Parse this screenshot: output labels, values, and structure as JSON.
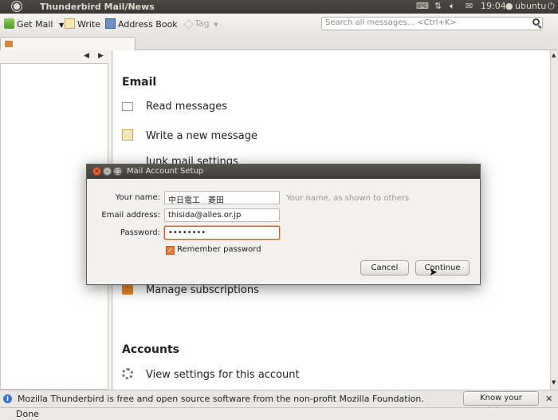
{
  "top_panel": {
    "title": "Thunderbird Mail/News",
    "time": "19:04",
    "user": "ubuntu"
  },
  "toolbar": {
    "get_mail": "Get Mail",
    "write": "Write",
    "address_book": "Address Book",
    "tag": "Tag",
    "search_placeholder": "Search all messages... <Ctrl+K>"
  },
  "content": {
    "email_heading": "Email",
    "read_messages": "Read messages",
    "write_message": "Write a new message",
    "junk_settings": "Junk mail settings",
    "manage_subscriptions": "Manage subscriptions",
    "accounts_heading": "Accounts",
    "view_settings": "View settings for this account"
  },
  "dialog": {
    "title": "Mail Account Setup",
    "name_label": "Your name:",
    "name_value": "中日電工　菱田",
    "name_hint": "Your name, as shown to others",
    "email_label": "Email address:",
    "email_value": "thisida@alles.or.jp",
    "password_label": "Password:",
    "password_value": "••••••••",
    "remember_label": "Remember password",
    "remember_checked": true,
    "cancel": "Cancel",
    "continue": "Continue"
  },
  "notification": {
    "message": "Mozilla Thunderbird is free and open source software from the non-profit Mozilla Foundation.",
    "rights_button": "Know your rights..."
  },
  "status": {
    "text": "Done"
  },
  "colors": {
    "panel": "#3c3b37",
    "accent": "#e0542e",
    "info": "#3b74c7"
  }
}
